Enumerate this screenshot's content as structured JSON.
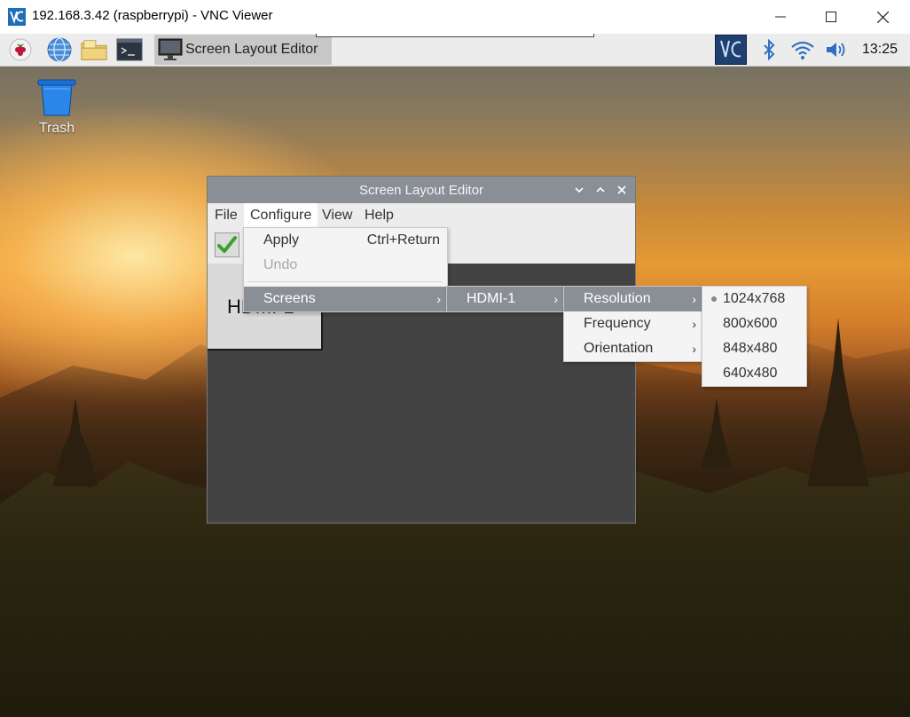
{
  "host_window": {
    "title": "192.168.3.42 (raspberrypi) - VNC Viewer",
    "minimize_glyph": "—",
    "maximize_glyph": "☐",
    "close_glyph": "✕"
  },
  "taskbar": {
    "task_label": "Screen Layout Editor",
    "clock": "13:25",
    "launchers": [
      "raspberry-menu-icon",
      "web-browser-icon",
      "file-manager-icon",
      "terminal-icon"
    ],
    "tray": [
      "vnc-server-icon",
      "bluetooth-icon",
      "wifi-icon",
      "volume-icon"
    ]
  },
  "desktop": {
    "trash_label": "Trash"
  },
  "editor": {
    "title": "Screen Layout Editor",
    "menus": [
      "File",
      "Configure",
      "View",
      "Help"
    ],
    "active_menu": "Configure",
    "monitor_label": "HDMI-1"
  },
  "configure_menu": {
    "apply": "Apply",
    "apply_shortcut": "Ctrl+Return",
    "undo": "Undo",
    "screens": "Screens"
  },
  "screens_menu": {
    "items": [
      "HDMI-1"
    ]
  },
  "hdmi_menu": {
    "items": [
      "Resolution",
      "Frequency",
      "Orientation"
    ]
  },
  "resolution_menu": {
    "selected": "1024x768",
    "items": [
      "1024x768",
      "800x600",
      "848x480",
      "640x480"
    ]
  },
  "colors": {
    "menu_highlight": "#8a8f96",
    "titlebar": "#8a8f96",
    "canvas": "#434343",
    "vnc_blue": "#1d6fb8"
  }
}
